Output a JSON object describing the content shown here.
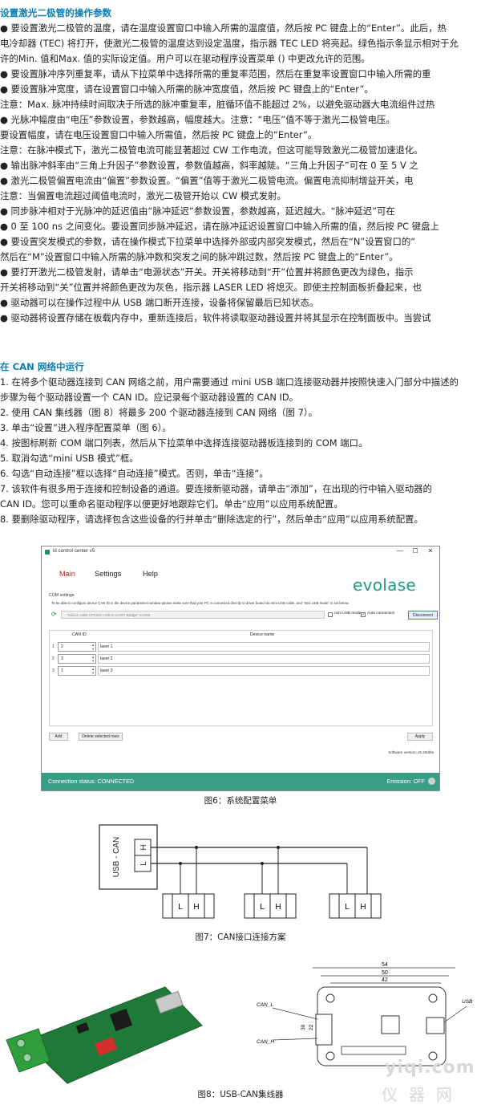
{
  "section1": {
    "heading": "设置激光二极管的操作参数",
    "lines": [
      "● 要设置激光二极管的温度，请在温度设置窗口中输入所需的温度值，然后按 PC 键盘上的“Enter”。此后，热",
      "电冷却器 (TEC) 将打开，使激光二极管的温度达到设定温度，指示器 TEC LED 将亮起。绿色指示条显示相对于允",
      "许的Min. 值和Max. 值的实际设定值。用户可以在驱动程序设置菜单 () 中更改允许的范围。",
      "● 要设置脉冲序列重复率，请从下拉菜单中选择所需的重复率范围，然后在重复率设置窗口中输入所需的重",
      "● 要设置脉冲宽度，请在设置窗口中输入所需的脉冲宽度值，然后按 PC 键盘上的“Enter”。",
      "注意：Max. 脉冲持续时间取决于所选的脉冲重复率，脏循环值不能超过 2%，以避免驱动器大电流组件过热",
      "● 光脉冲幅度由“电压”参数设置，参数越高，幅度越大。注意：“电压”值不等于激光二极管电压。",
      "要设置幅度，请在电压设置窗口中输入所需值，然后按 PC 键盘上的“Enter”。",
      "注意：在脉冲模式下，激光二极管电流可能显著超过 CW 工作电流，但这可能导致激光二极管加速退化。",
      "● 输出脉冲斜率由“三角上升因子”参数设置，参数值越高，斜率越陡。“三角上升因子”可在 0 至 5 V 之",
      "● 激光二极管偏置电流由“偏置”参数设置。“偏置”值等于激光二极管电流。偏置电流抑制增益开关，电",
      "注意：当偏置电流超过阈值电流时，激光二极管开始以 CW 模式发射。",
      "● 同步脉冲相对于光脉冲的延迟值由“脉冲延迟”参数设置，参数越高，延迟越大。“脉冲延迟”可在",
      "● 0 至 100 ns 之间变化。要设置同步脉冲延迟，请在脉冲延迟设置窗口中输入所需的值，然后按 PC 键盘上",
      "● 要设置突发模式的参数，请在操作模式下拉菜单中选择外部或内部突发模式，然后在“N”设置窗口的“",
      "然后在“M”设置窗口中输入所需的脉冲数和突发之间的脉冲跳过数，然后按 PC 键盘上的“Enter”。",
      "● 要打开激光二极管发射，请单击“电源状态”开关。开关将移动到“开”位置并将颜色更改为绿色，指示",
      "开关将移动到“关”位置并将颜色更改为灰色，指示器 LASER LED 将熄灭。即使主控制面板折叠起来，也",
      "● 驱动器可以在操作过程中从 USB 端口断开连接，设备将保留最后已知状态。",
      "● 驱动器将设置存储在板载内存中，重新连接后，软件将读取驱动器设置并将其显示在控制面板中。当尝试"
    ]
  },
  "section2": {
    "heading": "在 CAN 网络中运行",
    "lines": [
      "1. 在将多个驱动器连接到 CAN 网络之前，用户需要通过 mini USB 端口连接驱动器并按照快速入门部分中描述的",
      "步骤为每个驱动器设置一个 CAN ID。应记录每个驱动器设置的 CAN ID。",
      "2. 使用 CAN 集线器（图 8）将最多 200 个驱动器连接到 CAN 网络（图 7）。",
      "3. 单击“设置”进入程序配置菜单（图 6）。",
      "4. 按图标刷新 COM 端口列表，然后从下拉菜单中选择连接驱动器板连接到的 COM 端口。",
      "5. 取消勾选“mini USB 模式”框。",
      "6. 勾选“自动连接”框以选择“自动连接”模式。否则，单击“连接”。",
      "7. 该软件有很多用于连接和控制设备的通道。要连接新驱动器，请单击“添加”，在出现的行中输入驱动器的",
      "CAN ID。您可以重命名驱动程序以便更好地跟踪它们。单击“应用”以应用系统配置。",
      "8. 要删除驱动程序，请选择包含这些设备的行并单击“删除选定的行”，然后单击“应用”以应用系统配置。"
    ]
  },
  "app": {
    "title": "ld control center v5",
    "window_controls": [
      "—",
      "☐",
      "✕"
    ],
    "menu": [
      "Main",
      "Settings",
      "Help"
    ],
    "logo": "evolase",
    "com_settings": {
      "label": "COM settings",
      "note": "To be able to configure device CAN ID in the device parameters window please make sure that your PC is connected directly to driver board via mini-USB cable, and \"mini USB mode\" is set below.",
      "port": "\"Silicon Labs CP210x USB to UART Bridge\" COM4",
      "mini_usb_mode_label": "mini USB mode",
      "mini_usb_mode_checked": false,
      "auto_connection_label": "Auto connection",
      "auto_connection_checked": true,
      "disconnect_label": "Disconnect"
    },
    "table": {
      "col_can_id": "CAN ID",
      "col_device_name": "Device name",
      "rows": [
        {
          "num": "1",
          "can_id": "2",
          "name": "laser 1"
        },
        {
          "num": "2",
          "can_id": "3",
          "name": "laser 2"
        },
        {
          "num": "3",
          "can_id": "1",
          "name": "laser 3"
        }
      ]
    },
    "add_label": "Add",
    "delete_label": "Delete selected rows",
    "apply_label": "Apply",
    "software_version": "Software version: v5.2t4dbs",
    "connection_status": "Connection status: CONNECTED",
    "emission": "Emission: OFF"
  },
  "captions": {
    "fig6": "图6：系统配置菜单",
    "fig7": "图7：CAN接口连接方案",
    "fig8": "图8：USB-CAN集线器"
  },
  "fig7": {
    "box_label": "USB - CAN",
    "h": "H",
    "l": "L"
  },
  "fig8": {
    "board_label": "USB-CAN",
    "dim_54": "54",
    "dim_50": "50",
    "dim_42": "42",
    "dim_30": "30",
    "dim_22": "22",
    "can_l": "CAN_L",
    "can_h": "CAN_H",
    "usb": "USB"
  },
  "watermark": {
    "line1": "yiqi.com",
    "line2": "仪器网"
  }
}
